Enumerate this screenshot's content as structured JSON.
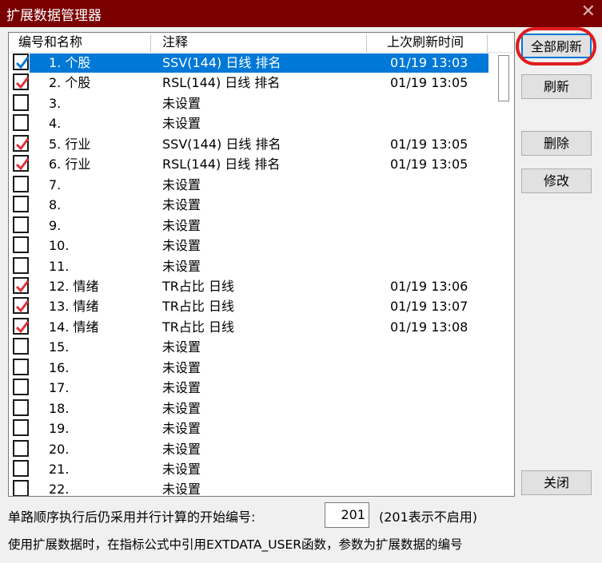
{
  "window": {
    "title": "扩展数据管理器",
    "close_glyph": "✕"
  },
  "columns": {
    "name": "编号和名称",
    "note": "注释",
    "time": "上次刷新时间"
  },
  "rows": [
    {
      "checked": true,
      "name": "1. 个股",
      "note": "SSV(144) 日线 排名",
      "time": "01/19 13:03",
      "selected": true
    },
    {
      "checked": true,
      "name": "2. 个股",
      "note": "RSL(144) 日线 排名",
      "time": "01/19 13:05"
    },
    {
      "checked": false,
      "name": "3.",
      "note": "未设置",
      "time": ""
    },
    {
      "checked": false,
      "name": "4.",
      "note": "未设置",
      "time": ""
    },
    {
      "checked": true,
      "name": "5. 行业",
      "note": "SSV(144) 日线 排名",
      "time": "01/19 13:05"
    },
    {
      "checked": true,
      "name": "6. 行业",
      "note": "RSL(144) 日线 排名",
      "time": "01/19 13:05"
    },
    {
      "checked": false,
      "name": "7.",
      "note": "未设置",
      "time": ""
    },
    {
      "checked": false,
      "name": "8.",
      "note": "未设置",
      "time": ""
    },
    {
      "checked": false,
      "name": "9.",
      "note": "未设置",
      "time": ""
    },
    {
      "checked": false,
      "name": "10.",
      "note": "未设置",
      "time": ""
    },
    {
      "checked": false,
      "name": "11.",
      "note": "未设置",
      "time": ""
    },
    {
      "checked": true,
      "name": "12. 情绪",
      "note": "TR占比 日线",
      "time": "01/19 13:06"
    },
    {
      "checked": true,
      "name": "13. 情绪",
      "note": "TR占比 日线",
      "time": "01/19 13:07"
    },
    {
      "checked": true,
      "name": "14. 情绪",
      "note": "TR占比 日线",
      "time": "01/19 13:08"
    },
    {
      "checked": false,
      "name": "15.",
      "note": "未设置",
      "time": ""
    },
    {
      "checked": false,
      "name": "16.",
      "note": "未设置",
      "time": ""
    },
    {
      "checked": false,
      "name": "17.",
      "note": "未设置",
      "time": ""
    },
    {
      "checked": false,
      "name": "18.",
      "note": "未设置",
      "time": ""
    },
    {
      "checked": false,
      "name": "19.",
      "note": "未设置",
      "time": ""
    },
    {
      "checked": false,
      "name": "20.",
      "note": "未设置",
      "time": ""
    },
    {
      "checked": false,
      "name": "21.",
      "note": "未设置",
      "time": ""
    },
    {
      "checked": false,
      "name": "22.",
      "note": "未设置",
      "time": ""
    }
  ],
  "buttons": {
    "refresh_all": "全部刷新",
    "refresh": "刷新",
    "delete": "删除",
    "modify": "修改",
    "close": "关闭"
  },
  "footer": {
    "start_label": "单路顺序执行后仍采用并行计算的开始编号:",
    "start_value": "201",
    "start_hint": "(201表示不启用)",
    "usage_note": "使用扩展数据时，在指标公式中引用EXTDATA_USER函数，参数为扩展数据的编号"
  },
  "colors": {
    "title_bg": "#7a0000",
    "selection": "#0078d7",
    "check": "#e0303a",
    "annotation": "#e11c1c"
  }
}
